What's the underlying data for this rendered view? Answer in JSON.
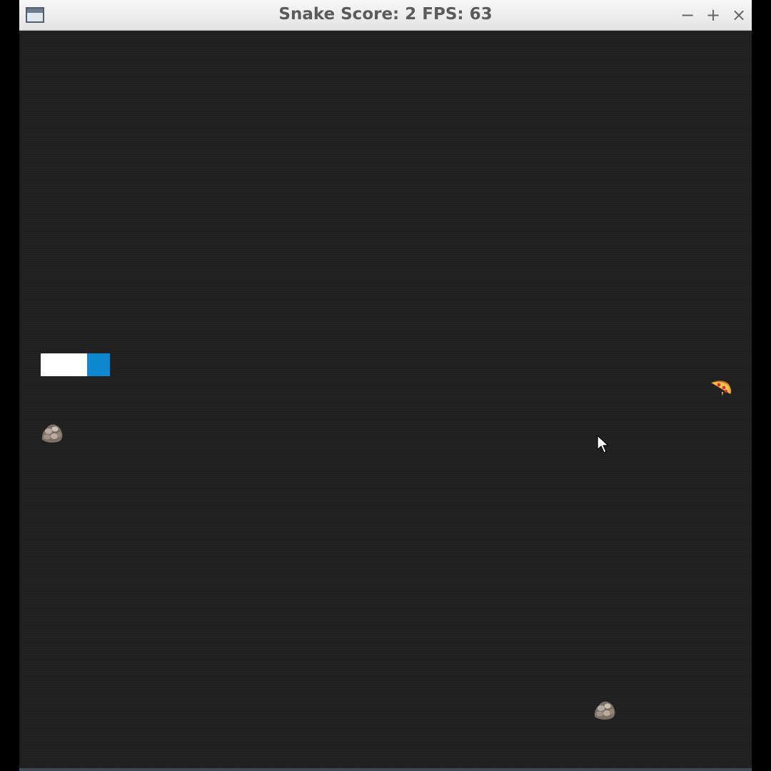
{
  "window": {
    "title": "Snake Score: 2 FPS: 63",
    "controls": {
      "minimize": "−",
      "maximize": "+",
      "close": "×"
    }
  },
  "game": {
    "score": 2,
    "fps": 63,
    "snake_color": "#0f86d0",
    "snake_body_color": "#ffffff",
    "background_color": "#202020",
    "food_icon": "pizza-icon",
    "obstacle_icon": "rock-icon"
  }
}
